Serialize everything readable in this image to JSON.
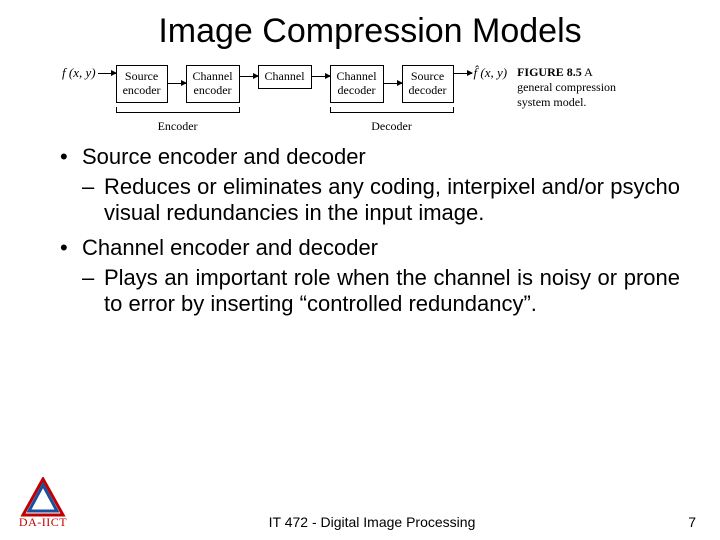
{
  "title": "Image Compression Models",
  "diagram": {
    "input": "f (x, y)",
    "boxes": [
      "Source\nencoder",
      "Channel\nencoder",
      "Channel",
      "Channel\ndecoder",
      "Source\ndecoder"
    ],
    "output": "f̂ (x, y)",
    "group_left": "Encoder",
    "group_right": "Decoder",
    "fig_num": "FIGURE 8.5",
    "fig_text": "A general compression system model."
  },
  "bullets": [
    {
      "text": "Source encoder and decoder",
      "sub": "Reduces or eliminates any coding, interpixel and/or psycho visual redundancies in the input image."
    },
    {
      "text": "Channel encoder and decoder",
      "sub": "Plays an important role when the channel is noisy or prone to error by inserting “controlled redundancy”."
    }
  ],
  "footer": {
    "course": "IT 472 - Digital Image Processing",
    "page": "7",
    "logo_text": "DA-IICT"
  }
}
